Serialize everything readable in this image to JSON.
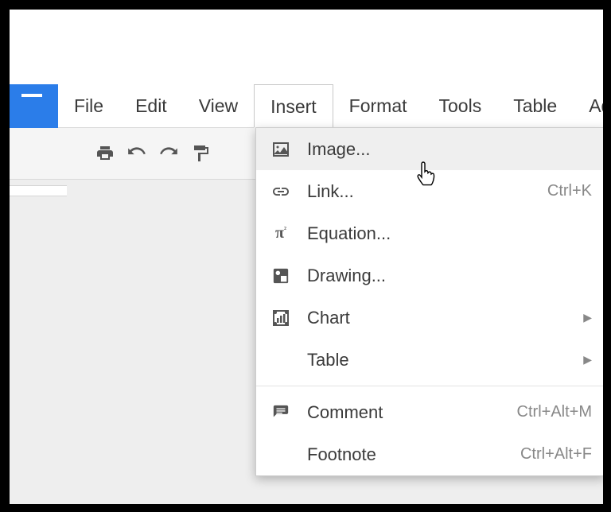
{
  "menubar": {
    "items": [
      {
        "label": "File"
      },
      {
        "label": "Edit"
      },
      {
        "label": "View"
      },
      {
        "label": "Insert"
      },
      {
        "label": "Format"
      },
      {
        "label": "Tools"
      },
      {
        "label": "Table"
      },
      {
        "label": "Add-o"
      }
    ],
    "active_index": 3
  },
  "insert_menu": {
    "items": [
      {
        "label": "Image...",
        "shortcut": "",
        "submenu": false
      },
      {
        "label": "Link...",
        "shortcut": "Ctrl+K",
        "submenu": false
      },
      {
        "label": "Equation...",
        "shortcut": "",
        "submenu": false
      },
      {
        "label": "Drawing...",
        "shortcut": "",
        "submenu": false
      },
      {
        "label": "Chart",
        "shortcut": "",
        "submenu": true
      },
      {
        "label": "Table",
        "shortcut": "",
        "submenu": true
      }
    ],
    "items2": [
      {
        "label": "Comment",
        "shortcut": "Ctrl+Alt+M",
        "submenu": false
      },
      {
        "label": "Footnote",
        "shortcut": "Ctrl+Alt+F",
        "submenu": false
      }
    ]
  }
}
